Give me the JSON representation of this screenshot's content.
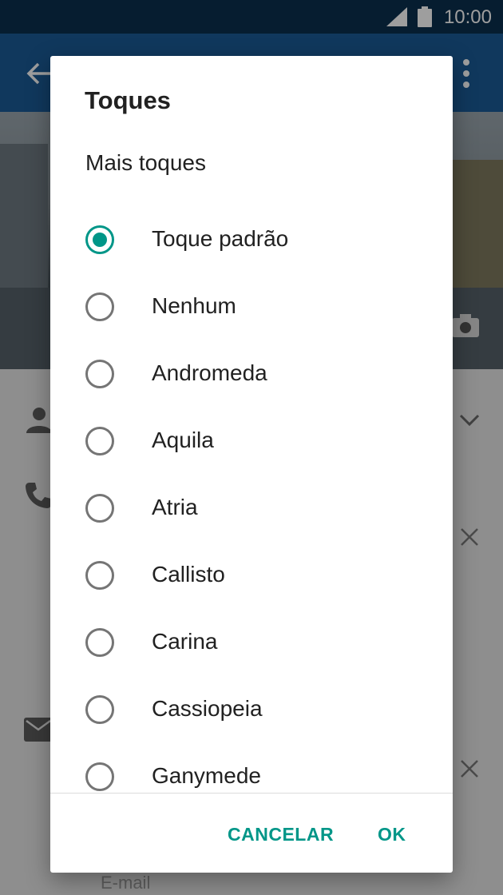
{
  "status_bar": {
    "time": "10:00",
    "icons": [
      "signal-icon",
      "battery-icon"
    ]
  },
  "app_bar": {
    "icons": [
      "back-arrow-icon",
      "more-vert-icon"
    ]
  },
  "background_form": {
    "icons": [
      "person-icon",
      "chevron-down-icon",
      "phone-icon",
      "clear-icon",
      "email-icon",
      "clear-icon"
    ],
    "email_label": "E-mail"
  },
  "dialog": {
    "title": "Toques",
    "more_label": "Mais toques",
    "selected_index": 0,
    "options": [
      {
        "label": "Toque padrão",
        "selected": true
      },
      {
        "label": "Nenhum",
        "selected": false
      },
      {
        "label": "Andromeda",
        "selected": false
      },
      {
        "label": "Aquila",
        "selected": false
      },
      {
        "label": "Atria",
        "selected": false
      },
      {
        "label": "Callisto",
        "selected": false
      },
      {
        "label": "Carina",
        "selected": false
      },
      {
        "label": "Cassiopeia",
        "selected": false
      },
      {
        "label": "Ganymede",
        "selected": false
      }
    ],
    "cancel_label": "CANCELAR",
    "ok_label": "OK"
  },
  "colors": {
    "accent": "#009688",
    "app_bar": "#1a5b97",
    "status_bar": "#0a2f4e"
  }
}
